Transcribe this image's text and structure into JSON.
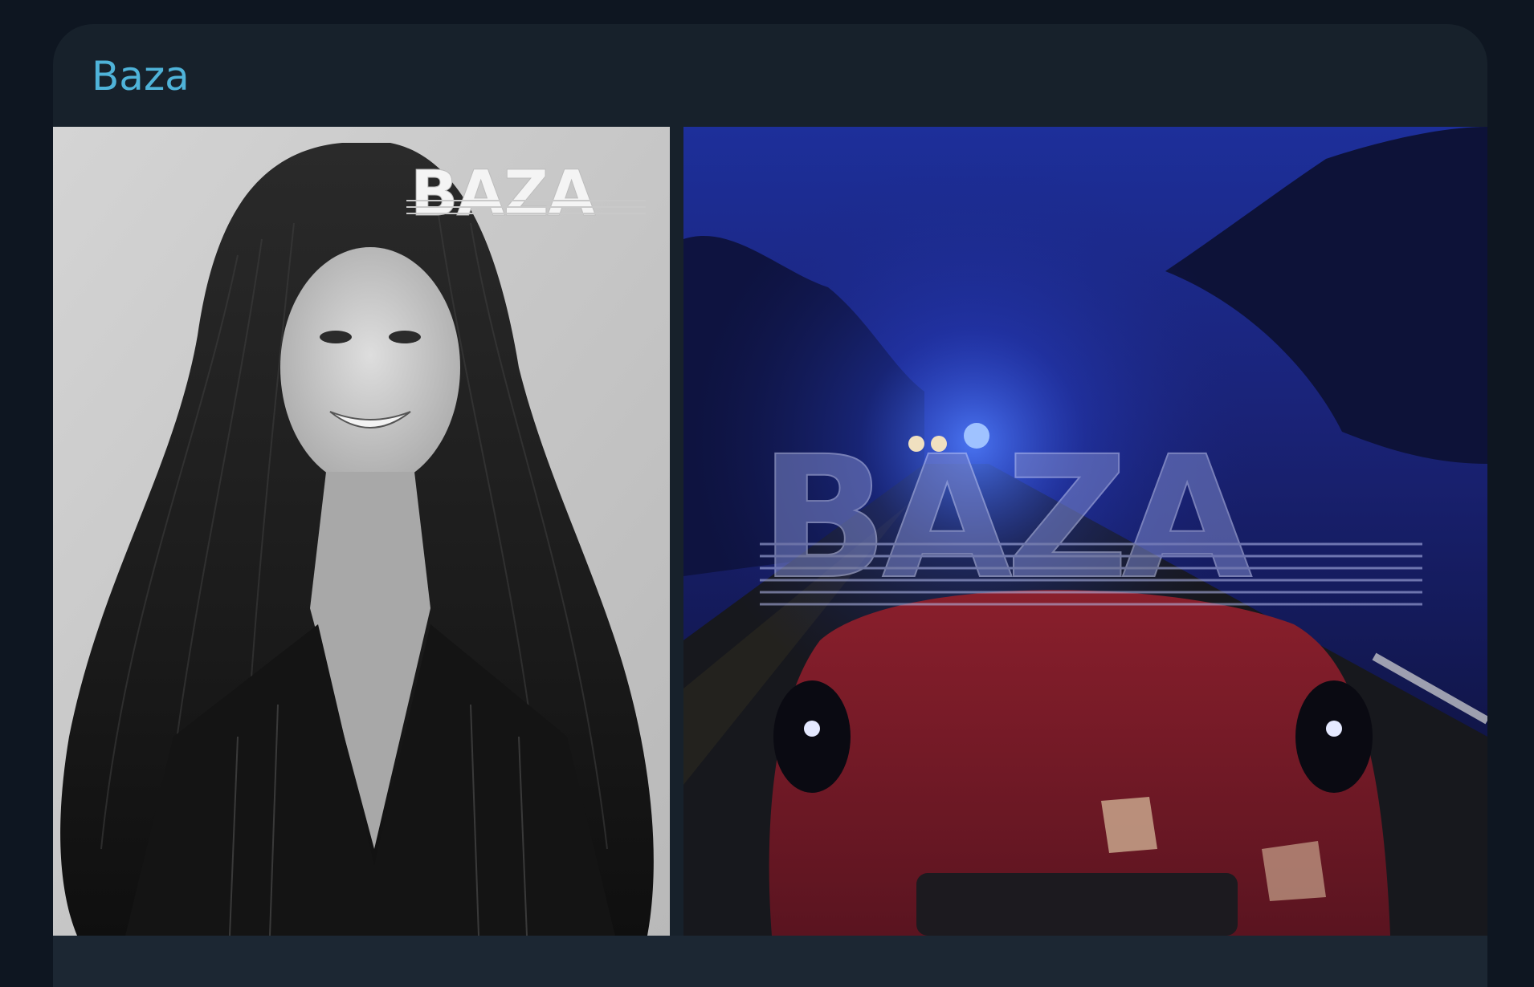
{
  "message": {
    "sender_name": "Baza"
  },
  "media": [
    {
      "kind": "photo",
      "subject": "portrait",
      "watermark": "BAZA",
      "palette": "grayscale"
    },
    {
      "kind": "photo",
      "subject": "car-on-road-at-night",
      "watermark": "BAZA",
      "palette": "night-blue"
    }
  ],
  "colors": {
    "app_background": "#0e1621",
    "bubble_background": "#17212b",
    "sender_name": "#4fb3d9"
  }
}
